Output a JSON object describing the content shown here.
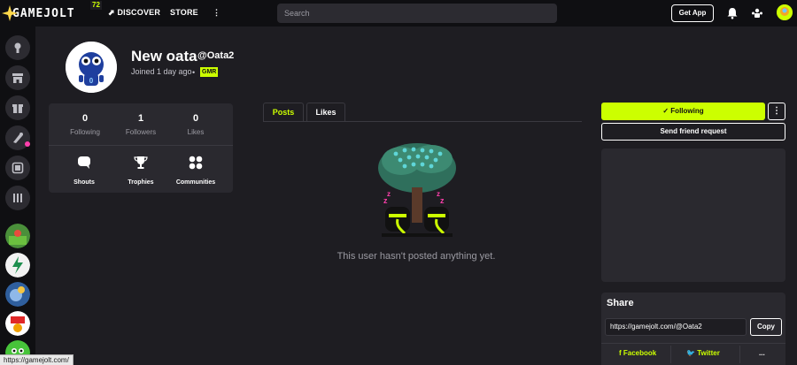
{
  "app": {
    "logo_text": "GAMEJOLT",
    "logo_badge": "72",
    "nav": {
      "discover": "DISCOVER",
      "store": "STORE",
      "more": "⋮"
    },
    "search_placeholder": "Search",
    "get_app": "Get App"
  },
  "profile": {
    "display_name": "New oata",
    "username": "@Oata2",
    "joined": "Joined 1 day ago",
    "badge": "GMR",
    "stats": [
      {
        "value": "0",
        "label": "Following"
      },
      {
        "value": "1",
        "label": "Followers"
      },
      {
        "value": "0",
        "label": "Likes"
      }
    ],
    "shortcuts": [
      {
        "label": "Shouts",
        "icon": "chat-bubble-icon"
      },
      {
        "label": "Trophies",
        "icon": "trophy-icon"
      },
      {
        "label": "Communities",
        "icon": "communities-icon"
      }
    ]
  },
  "tabs": [
    {
      "label": "Posts",
      "active": true
    },
    {
      "label": "Likes",
      "active": false
    }
  ],
  "empty_message": "This user hasn't posted anything yet.",
  "actions": {
    "following": "Following",
    "more": "⋮",
    "friend_request": "Send friend request"
  },
  "share": {
    "title": "Share",
    "url": "https://gamejolt.com/@Oata2",
    "copy": "Copy",
    "facebook": "Facebook",
    "twitter": "Twitter",
    "more": "..."
  },
  "status_tip": "https://gamejolt.com/",
  "colors": {
    "accent": "#ccff00",
    "background": "#1e1d22",
    "rail": "#0f0f12",
    "card": "#2a292f",
    "notify": "#ff3fac"
  }
}
